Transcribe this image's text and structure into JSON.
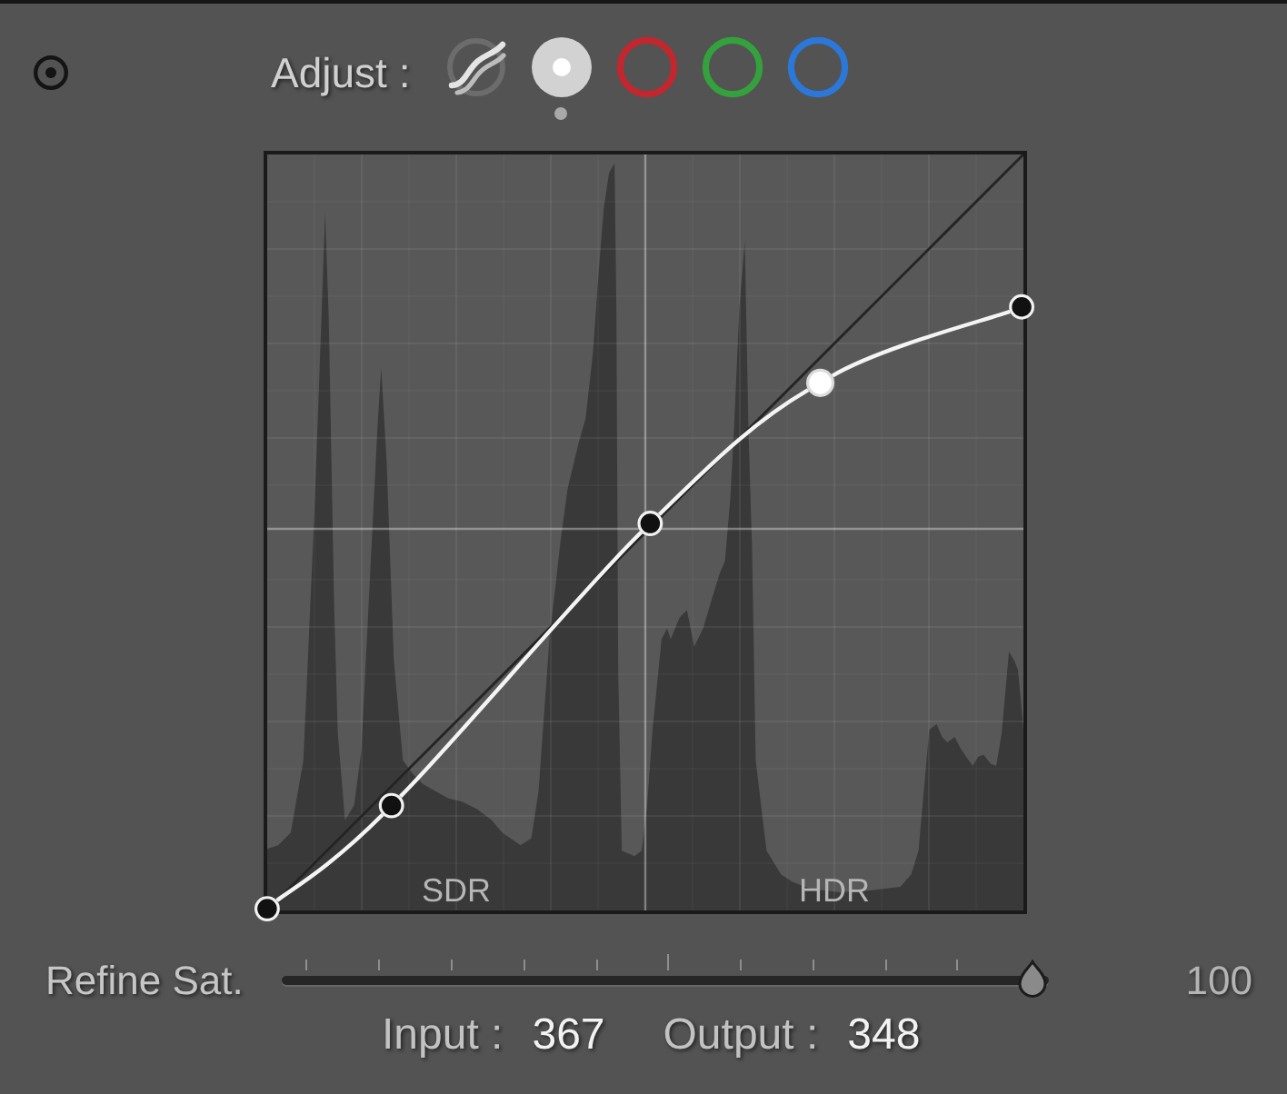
{
  "adjust": {
    "label": "Adjust :",
    "channels": [
      {
        "kind": "parametric",
        "selected": false
      },
      {
        "kind": "luminance",
        "selected": true
      },
      {
        "kind": "ring",
        "color": "#c4262e",
        "selected": false
      },
      {
        "kind": "ring",
        "color": "#33a23c",
        "selected": false
      },
      {
        "kind": "ring",
        "color": "#2b78da",
        "selected": false
      }
    ]
  },
  "curve": {
    "region_labels": [
      "SDR",
      "HDR"
    ],
    "points": [
      {
        "selected": false
      },
      {
        "selected": false
      },
      {
        "selected": false
      },
      {
        "selected": true
      },
      {
        "selected": false
      }
    ]
  },
  "slider": {
    "label": "Refine Sat.",
    "level": 1,
    "value": "100"
  },
  "readout": {
    "input_label": "Input :",
    "input_value": "367",
    "output_label": "Output :",
    "output_value": "348"
  }
}
